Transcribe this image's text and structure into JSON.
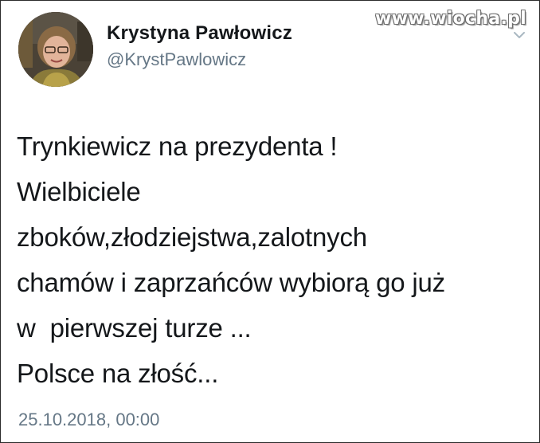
{
  "author": {
    "display_name": "Krystyna Pawłowicz",
    "handle": "@KrystPawlowicz"
  },
  "watermark": "www.wiocha.pl",
  "tweet": {
    "lines": [
      "Trynkiewicz na prezydenta !",
      "Wielbiciele",
      "zboków,złodziejstwa,zalotnych",
      "chamów i zaprzańców wybiorą go już",
      "w  pierwszej turze ...",
      "Polsce na złość..."
    ],
    "timestamp": "25.10.2018, 00:00"
  },
  "icons": {
    "avatar": "profile-photo",
    "menu": "chevron-down-icon"
  },
  "colors": {
    "text": "#14171a",
    "secondary_text": "#657786",
    "border": "#2b2b2b"
  }
}
